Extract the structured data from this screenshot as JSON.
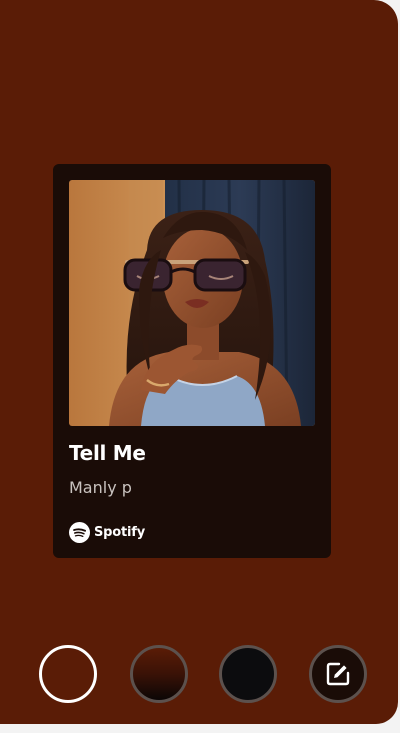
{
  "share_card": {
    "track_title": "Tell Me",
    "artist": "Manly p",
    "brand_label": "Spotify",
    "artwork_icon": "album-artwork"
  },
  "background_options": [
    {
      "name": "background-option-solid",
      "color": "#5a1c06",
      "selected": true
    },
    {
      "name": "background-option-gradient",
      "color": "#5a1c06",
      "selected": false
    },
    {
      "name": "background-option-dark",
      "color": "#0c0c0e",
      "selected": false
    },
    {
      "name": "edit-background-button",
      "icon": "edit-image-icon",
      "selected": false
    }
  ],
  "colors": {
    "sheet": "#5a1c06",
    "card": "#1a0c07",
    "title": "#ffffff",
    "artist": "#c9c3bf"
  }
}
